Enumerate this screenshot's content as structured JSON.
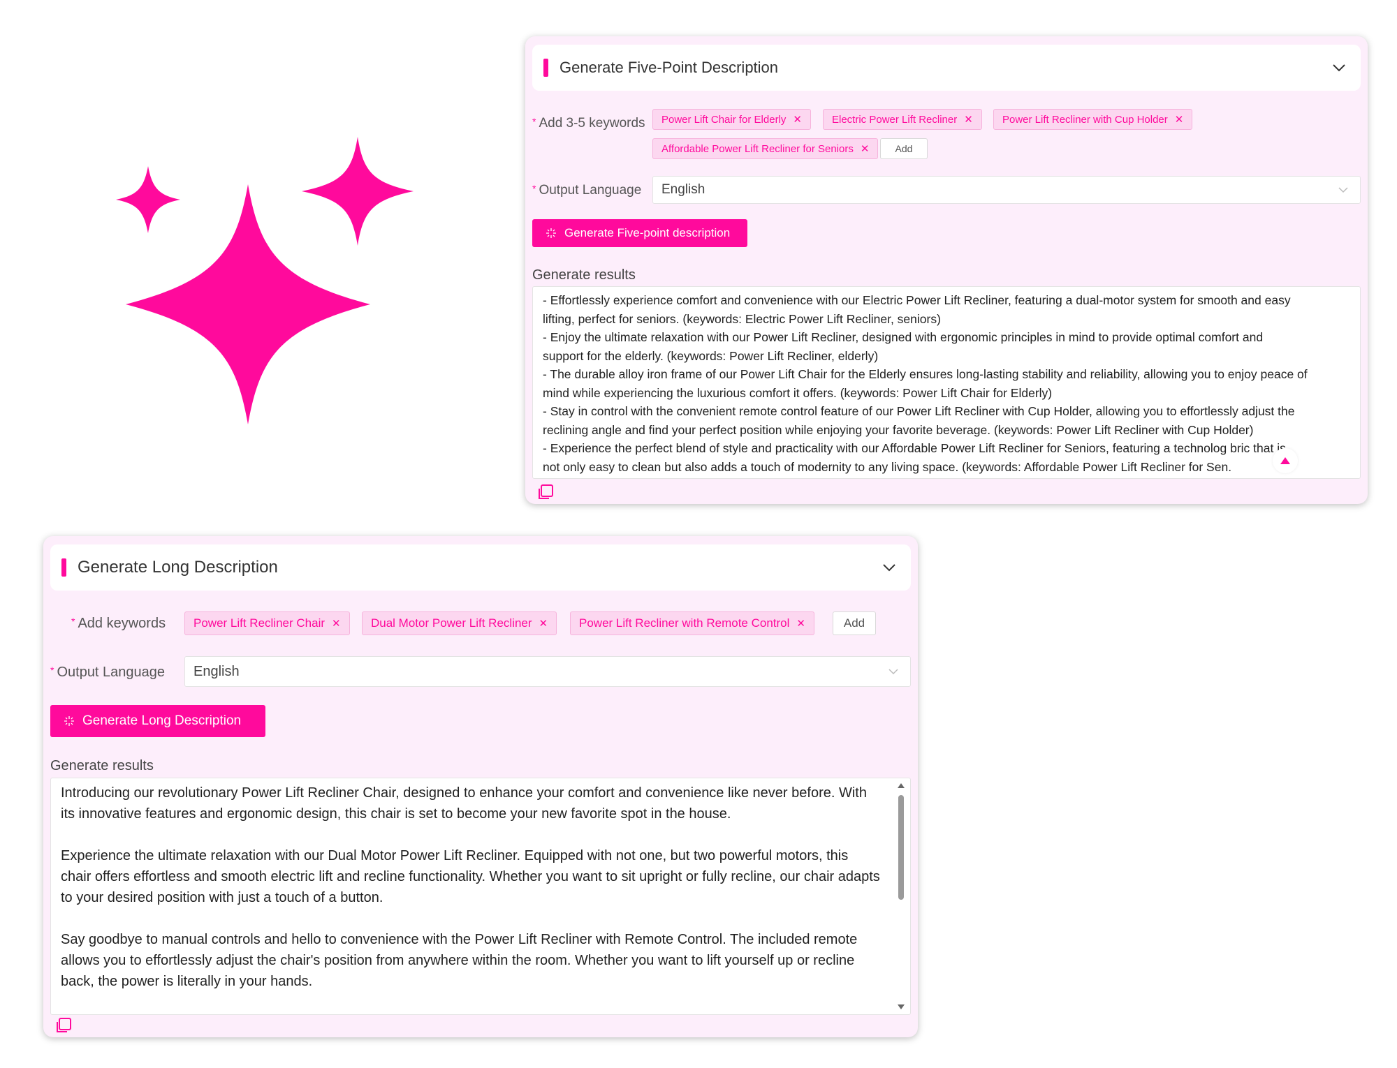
{
  "colors": {
    "accent": "#ff0a9c",
    "panel_bg": "#fdeefb",
    "tag_bg": "#fcd7f0"
  },
  "logo": {
    "icon": "sparkle-icon"
  },
  "five_point": {
    "title": "Generate Five-Point Description",
    "keywords_label": "Add 3-5 keywords",
    "keywords": [
      "Power Lift Chair for Elderly",
      "Electric Power Lift Recliner",
      "Power Lift Recliner with Cup Holder",
      "Affordable Power Lift Recliner for Seniors"
    ],
    "add_label": "Add",
    "language_label": "Output Language",
    "language_value": "English",
    "generate_label": "Generate Five-point description",
    "results_label": "Generate results",
    "results_lines": [
      "- Effortlessly experience comfort and convenience with our Electric Power Lift Recliner, featuring a dual-motor system for smooth and easy",
      "lifting, perfect for seniors. (keywords: Electric Power Lift Recliner, seniors)",
      "- Enjoy the ultimate relaxation with our Power Lift Recliner, designed with ergonomic principles in mind to provide optimal comfort and",
      "support for the elderly. (keywords: Power Lift Recliner, elderly)",
      "- The durable alloy iron frame of our Power Lift Chair for the Elderly ensures long-lasting stability and reliability, allowing you to enjoy peace of",
      "mind while experiencing the luxurious comfort it offers. (keywords: Power Lift Chair for Elderly)",
      "- Stay in control with the convenient remote control feature of our Power Lift Recliner with Cup Holder, allowing you to effortlessly adjust the",
      "reclining angle and find your perfect position while enjoying your favorite beverage. (keywords: Power Lift Recliner with Cup Holder)",
      "- Experience the perfect blend of style and practicality with our Affordable Power Lift Recliner for Seniors, featuring a technolog   bric that is",
      "not only easy to clean but also adds a touch of modernity to any living space. (keywords: Affordable Power Lift Recliner for Sen."
    ]
  },
  "long": {
    "title": "Generate Long Description",
    "keywords_label": "Add keywords",
    "keywords": [
      "Power Lift Recliner Chair",
      "Dual Motor Power Lift Recliner",
      "Power Lift Recliner with Remote Control"
    ],
    "add_label": "Add",
    "language_label": "Output Language",
    "language_value": "English",
    "generate_label": "Generate Long Description",
    "results_label": "Generate results",
    "results_paragraphs": [
      "Introducing our revolutionary Power Lift Recliner Chair, designed to enhance your comfort and convenience like never before. With its innovative features and ergonomic design, this chair is set to become your new favorite spot in the house.",
      "Experience the ultimate relaxation with our Dual Motor Power Lift Recliner. Equipped with not one, but two powerful motors, this chair offers effortless and smooth electric lift and recline functionality. Whether you want to sit upright or fully recline, our chair adapts to your desired position with just a touch of a button.",
      "Say goodbye to manual controls and hello to convenience with the Power Lift Recliner with Remote Control. The included remote allows you to effortlessly adjust the chair's position from anywhere within the room. Whether you want to lift yourself up or recline back, the power is literally in your hands."
    ]
  }
}
